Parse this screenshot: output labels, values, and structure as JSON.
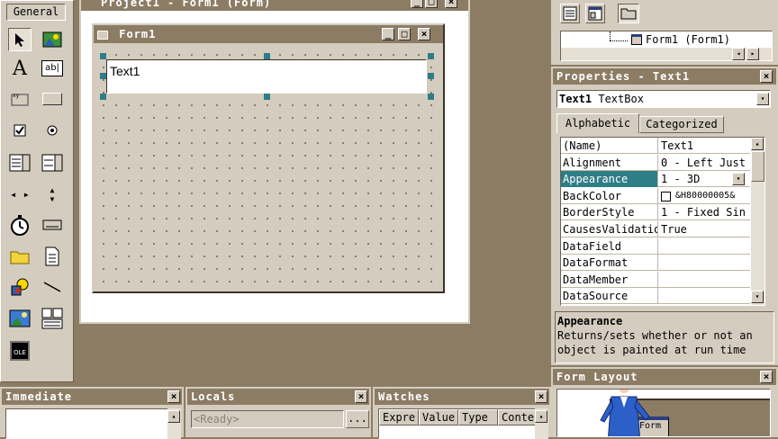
{
  "toolbox": {
    "title": "General",
    "tools": [
      {
        "name": "pointer-tool-icon",
        "glyph": "➤"
      },
      {
        "name": "picturebox-tool-icon",
        "glyph": "▣"
      },
      {
        "name": "label-tool-icon",
        "glyph": "A"
      },
      {
        "name": "textbox-tool-icon",
        "glyph": "ab|"
      },
      {
        "name": "frame-tool-icon",
        "glyph": "⌈⌉"
      },
      {
        "name": "commandbutton-tool-icon",
        "glyph": "▭"
      },
      {
        "name": "checkbox-tool-icon",
        "glyph": "☑"
      },
      {
        "name": "optionbutton-tool-icon",
        "glyph": "◉"
      },
      {
        "name": "combobox-tool-icon",
        "glyph": "▤"
      },
      {
        "name": "listbox-tool-icon",
        "glyph": "▦"
      },
      {
        "name": "hscrollbar-tool-icon",
        "glyph": "◂▸"
      },
      {
        "name": "vscrollbar-tool-icon",
        "glyph": "⇕"
      },
      {
        "name": "timer-tool-icon",
        "glyph": "⏱"
      },
      {
        "name": "drivelistbox-tool-icon",
        "glyph": "▬"
      },
      {
        "name": "dirlistbox-tool-icon",
        "glyph": "🗀"
      },
      {
        "name": "filelistbox-tool-icon",
        "glyph": "🗎"
      },
      {
        "name": "shape-tool-icon",
        "glyph": "◆"
      },
      {
        "name": "line-tool-icon",
        "glyph": "╲"
      },
      {
        "name": "image-tool-icon",
        "glyph": "▨"
      },
      {
        "name": "data-tool-icon",
        "glyph": "⊞"
      },
      {
        "name": "ole-tool-icon",
        "glyph": "OLE"
      }
    ]
  },
  "designer": {
    "window_title": "Project1 - Form1 (Form)",
    "form_title": "Form1",
    "textbox_text": "Text1"
  },
  "project": {
    "tree_item": "Form1 (Form1)"
  },
  "properties": {
    "title": "Properties - Text1",
    "object_name": "Text1",
    "object_type": "TextBox",
    "tab_alphabetic": "Alphabetic",
    "tab_categorized": "Categorized",
    "rows": [
      {
        "name": "(Name)",
        "value": "Text1"
      },
      {
        "name": "Alignment",
        "value": "0 - Left Just"
      },
      {
        "name": "Appearance",
        "value": "1 - 3D"
      },
      {
        "name": "BackColor",
        "value": "&H80000005&"
      },
      {
        "name": "BorderStyle",
        "value": "1 - Fixed Sin"
      },
      {
        "name": "CausesValidation",
        "value": "True"
      },
      {
        "name": "DataField",
        "value": ""
      },
      {
        "name": "DataFormat",
        "value": ""
      },
      {
        "name": "DataMember",
        "value": ""
      },
      {
        "name": "DataSource",
        "value": ""
      }
    ],
    "desc_title": "Appearance",
    "desc_text": "Returns/sets whether or not an object is painted at run time"
  },
  "form_layout": {
    "title": "Form Layout",
    "mini_form_label": "Form"
  },
  "immediate": {
    "title": "Immediate"
  },
  "locals": {
    "title": "Locals",
    "status": "<Ready>",
    "browse_label": "..."
  },
  "watches": {
    "title": "Watches",
    "columns": [
      "Expre",
      "Value",
      "Type",
      "Conte"
    ]
  },
  "colors": {
    "background": "#8c7c64",
    "panel": "#d4cdbf",
    "selection": "#2f7d87",
    "handle": "#2f7d87"
  }
}
